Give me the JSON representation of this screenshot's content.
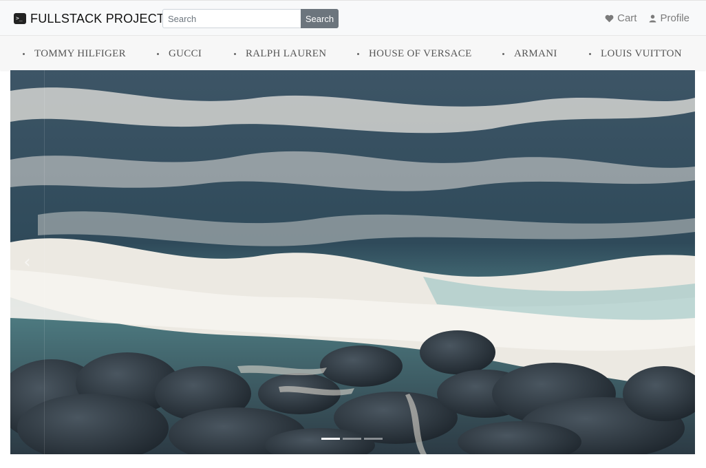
{
  "header": {
    "brand": "FULLSTACK PROJECT",
    "brand_icon": "terminal-icon",
    "search": {
      "placeholder": "Search",
      "button_label": "Search"
    },
    "links": [
      {
        "label": "Cart",
        "icon": "heart-icon"
      },
      {
        "label": "Profile",
        "icon": "user-icon"
      }
    ]
  },
  "brands": [
    "TOMMY HILFIGER",
    "GUCCI",
    "RALPH LAUREN",
    "HOUSE OF VERSACE",
    "ARMANI",
    "LOUIS VUITTON"
  ],
  "carousel": {
    "prev_icon": "chevron-left-icon",
    "slide_count": 3,
    "active_slide": 1
  },
  "colors": {
    "navbar_bg": "#f8f9fa",
    "search_button": "#6c757d",
    "nav_link": "#7b7b7b"
  }
}
